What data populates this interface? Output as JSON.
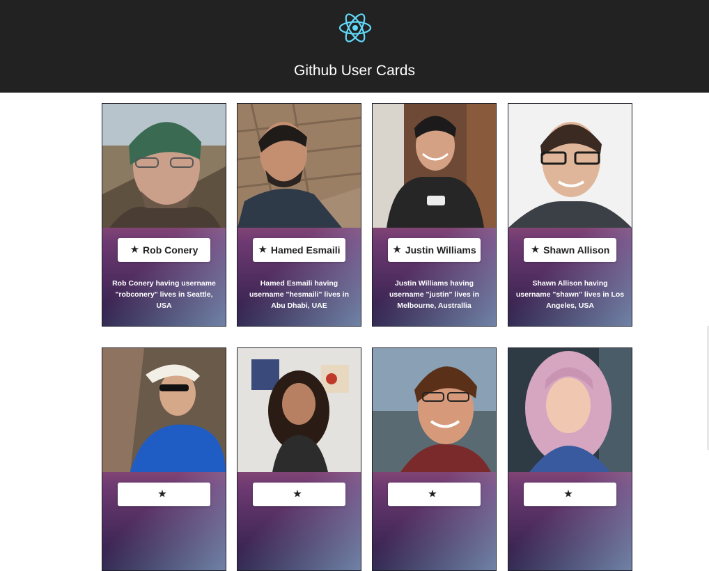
{
  "app": {
    "title": "Github User Cards",
    "logo_icon": "react-atom-icon",
    "logo_color": "#61dafb"
  },
  "users": [
    {
      "name": "Rob Conery",
      "username": "robconery",
      "description": "Rob Conery having username \"robconery\" lives in Seattle, USA"
    },
    {
      "name": "Hamed Esmaili",
      "username": "hesmaili",
      "description": "Hamed Esmaili having username \"hesmaili\" lives in Abu Dhabi, UAE"
    },
    {
      "name": "Justin Williams",
      "username": "justin",
      "description": "Justin Williams having username \"justin\" lives in Melbourne, Australlia"
    },
    {
      "name": "Shawn Allison",
      "username": "shawn",
      "description": "Shawn Allison having username \"shawn\" lives in Los Angeles, USA"
    },
    {
      "name": "",
      "username": "",
      "description": ""
    },
    {
      "name": "",
      "username": "",
      "description": ""
    },
    {
      "name": "",
      "username": "",
      "description": ""
    },
    {
      "name": "",
      "username": "",
      "description": ""
    }
  ],
  "card_button_icon": "star-icon"
}
